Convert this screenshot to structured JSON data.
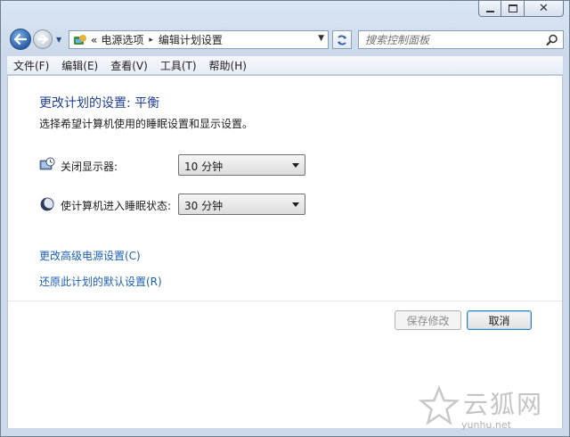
{
  "window": {
    "caption_buttons": {
      "minimize": "minimize",
      "maximize": "maximize",
      "close": "✕"
    }
  },
  "nav": {
    "breadcrumb_prefix": "«",
    "breadcrumb": [
      "电源选项",
      "编辑计划设置"
    ],
    "breadcrumb_separator": "▸",
    "search_placeholder": "搜索控制面板"
  },
  "menu": {
    "items": [
      "文件(F)",
      "编辑(E)",
      "查看(V)",
      "工具(T)",
      "帮助(H)"
    ]
  },
  "main": {
    "title": "更改计划的设置: 平衡",
    "subtitle": "选择希望计算机使用的睡眠设置和显示设置。",
    "settings": [
      {
        "label": "关闭显示器:",
        "value": "10 分钟",
        "icon": "monitor-clock-icon"
      },
      {
        "label": "使计算机进入睡眠状态:",
        "value": "30 分钟",
        "icon": "moon-icon"
      }
    ],
    "links": [
      "更改高级电源设置(C)",
      "还原此计划的默认设置(R)"
    ],
    "buttons": {
      "save": "保存修改",
      "cancel": "取消"
    }
  },
  "watermark": {
    "text_cn": "云狐网",
    "url": "yunhu.net"
  },
  "colors": {
    "title_blue": "#1e3f8f",
    "link_blue": "#1c5fb4",
    "chrome": "#cbd9ea"
  }
}
